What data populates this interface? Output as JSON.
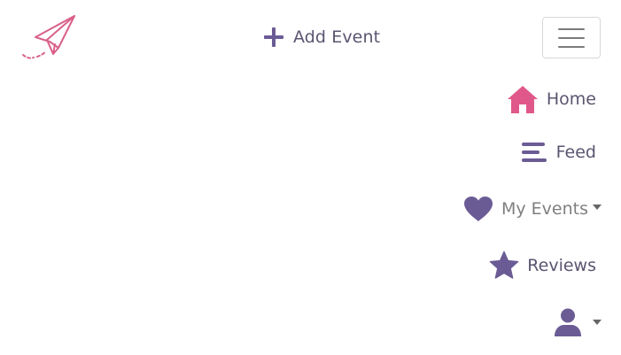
{
  "brand": {
    "logo_icon": "paper-plane-icon",
    "color": "#d9608a"
  },
  "header": {
    "add_event_label": "Add Event",
    "add_event_icon": "plus-icon",
    "menu_toggle_icon": "hamburger-icon"
  },
  "nav": {
    "items": [
      {
        "label": "Home",
        "icon": "house-icon",
        "color": "#e0588a"
      },
      {
        "label": "Feed",
        "icon": "list-icon",
        "color": "#6b5b95"
      },
      {
        "label": "My Events",
        "icon": "heart-icon",
        "color": "#6b5b95",
        "has_dropdown": true
      },
      {
        "label": "Reviews",
        "icon": "star-icon",
        "color": "#6b5b95"
      }
    ],
    "user_menu_icon": "user-icon"
  },
  "colors": {
    "accent_pink": "#e0588a",
    "accent_purple": "#6b5b95",
    "text": "#5b5470"
  }
}
